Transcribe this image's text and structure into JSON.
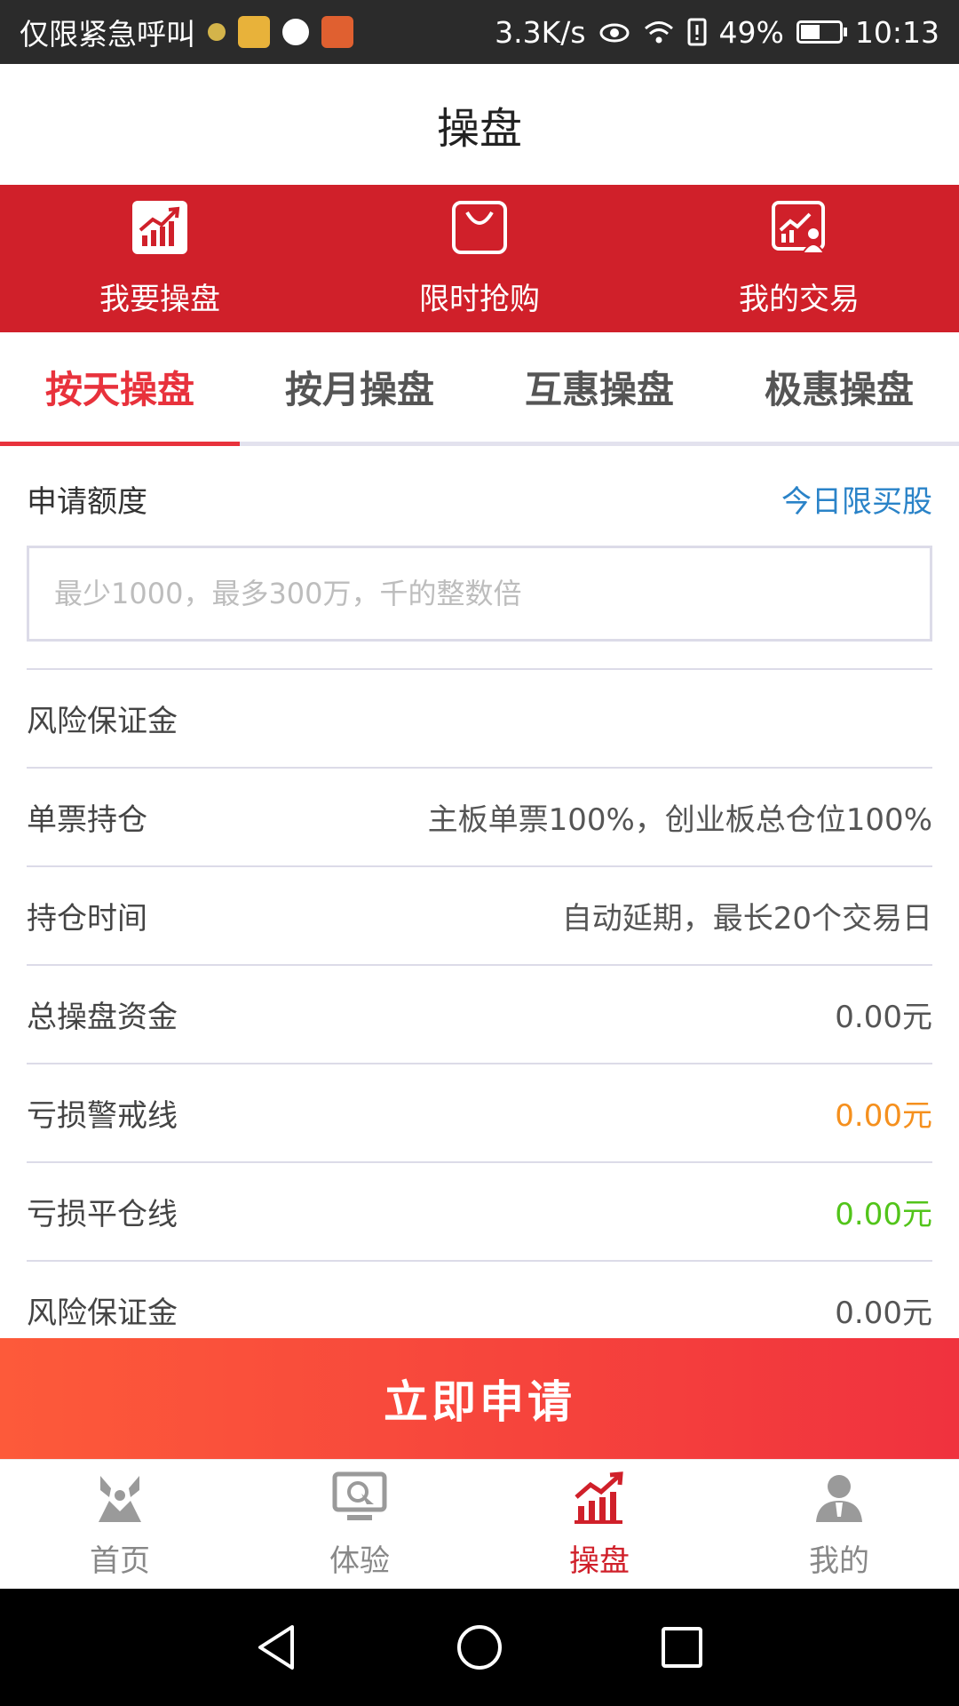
{
  "status_bar": {
    "carrier": "仅限紧急呼叫",
    "speed": "3.3K/s",
    "battery": "49%",
    "time": "10:13"
  },
  "header": {
    "title": "操盘"
  },
  "actions": [
    {
      "label": "我要操盘",
      "icon": "trend-chart-icon"
    },
    {
      "label": "限时抢购",
      "icon": "shopping-bag-icon"
    },
    {
      "label": "我的交易",
      "icon": "user-chart-icon"
    }
  ],
  "tabs": [
    {
      "label": "按天操盘",
      "active": true
    },
    {
      "label": "按月操盘",
      "active": false
    },
    {
      "label": "互惠操盘",
      "active": false
    },
    {
      "label": "极惠操盘",
      "active": false
    }
  ],
  "form": {
    "apply_label": "申请额度",
    "today_limit_link": "今日限买股",
    "amount_placeholder": "最少1000，最多300万，千的整数倍",
    "amount_value": ""
  },
  "rows": [
    {
      "label": "风险保证金",
      "value": ""
    },
    {
      "label": "单票持仓",
      "value": "主板单票100%，创业板总仓位100%"
    },
    {
      "label": "持仓时间",
      "value": "自动延期，最长20个交易日"
    },
    {
      "label": "总操盘资金",
      "value": "0.00元"
    },
    {
      "label": "亏损警戒线",
      "value": "0.00元",
      "color": "#f5901e"
    },
    {
      "label": "亏损平仓线",
      "value": "0.00元",
      "color": "#52c41a"
    },
    {
      "label": "风险保证金",
      "value": "0.00元"
    }
  ],
  "apply_button": {
    "label": "立即申请"
  },
  "bottom_nav": [
    {
      "label": "首页",
      "icon": "home-icon",
      "active": false
    },
    {
      "label": "体验",
      "icon": "monitor-icon",
      "active": false
    },
    {
      "label": "操盘",
      "icon": "trade-chart-icon",
      "active": true
    },
    {
      "label": "我的",
      "icon": "profile-icon",
      "active": false
    }
  ],
  "colors": {
    "brand_red": "#d0202a",
    "active_tab": "#e8323c",
    "link_blue": "#2a83c8",
    "warning_orange": "#f5901e",
    "close_green": "#52c41a"
  }
}
